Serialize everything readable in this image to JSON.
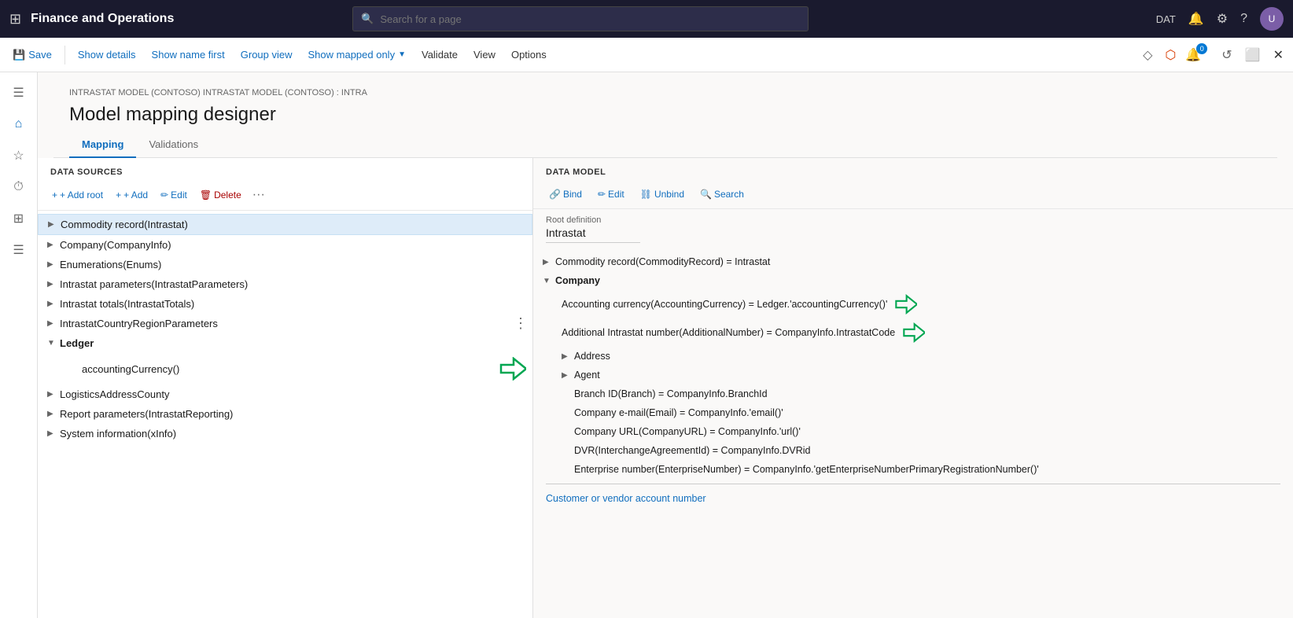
{
  "topNav": {
    "title": "Finance and Operations",
    "searchPlaceholder": "Search for a page",
    "environment": "DAT"
  },
  "toolbar": {
    "save": "Save",
    "showDetails": "Show details",
    "showNameFirst": "Show name first",
    "groupView": "Group view",
    "showMappedOnly": "Show mapped only",
    "validate": "Validate",
    "view": "View",
    "options": "Options"
  },
  "page": {
    "breadcrumb": "INTRASTAT MODEL (CONTOSO) INTRASTAT MODEL (CONTOSO) : INTRA",
    "title": "Model mapping designer",
    "tabs": [
      "Mapping",
      "Validations"
    ]
  },
  "dataSources": {
    "header": "DATA SOURCES",
    "addRoot": "+ Add root",
    "add": "+ Add",
    "edit": "Edit",
    "delete": "Delete",
    "items": [
      {
        "label": "Commodity record(Intrastat)",
        "expanded": false,
        "selected": true,
        "indent": 0,
        "hasChildren": true
      },
      {
        "label": "Company(CompanyInfo)",
        "expanded": false,
        "selected": false,
        "indent": 0,
        "hasChildren": true
      },
      {
        "label": "Enumerations(Enums)",
        "expanded": false,
        "selected": false,
        "indent": 0,
        "hasChildren": true
      },
      {
        "label": "Intrastat parameters(IntrastatParameters)",
        "expanded": false,
        "selected": false,
        "indent": 0,
        "hasChildren": true
      },
      {
        "label": "Intrastat totals(IntrastatTotals)",
        "expanded": false,
        "selected": false,
        "indent": 0,
        "hasChildren": true
      },
      {
        "label": "IntrastatCountryRegionParameters",
        "expanded": false,
        "selected": false,
        "indent": 0,
        "hasChildren": true
      },
      {
        "label": "Ledger",
        "expanded": true,
        "selected": false,
        "indent": 0,
        "hasChildren": true
      },
      {
        "label": "accountingCurrency()",
        "expanded": false,
        "selected": false,
        "indent": 1,
        "hasChildren": false,
        "arrow": true
      },
      {
        "label": "LogisticsAddressCounty",
        "expanded": false,
        "selected": false,
        "indent": 0,
        "hasChildren": true
      },
      {
        "label": "Report parameters(IntrastatReporting)",
        "expanded": false,
        "selected": false,
        "indent": 0,
        "hasChildren": true
      },
      {
        "label": "System information(xInfo)",
        "expanded": false,
        "selected": false,
        "indent": 0,
        "hasChildren": true
      }
    ]
  },
  "dataModel": {
    "header": "DATA MODEL",
    "bind": "Bind",
    "edit": "Edit",
    "unbind": "Unbind",
    "search": "Search",
    "rootDefinitionLabel": "Root definition",
    "rootDefinitionValue": "Intrastat",
    "items": [
      {
        "label": "Commodity record(CommodityRecord) = Intrastat",
        "indent": 0,
        "hasChildren": true,
        "expanded": false
      },
      {
        "label": "Company",
        "indent": 0,
        "hasChildren": true,
        "expanded": true
      },
      {
        "label": "Accounting currency(AccountingCurrency) = Ledger.'accountingCurrency()'",
        "indent": 1,
        "hasChildren": false,
        "arrow": true
      },
      {
        "label": "Additional Intrastat number(AdditionalNumber) = CompanyInfo.IntrastatCode",
        "indent": 1,
        "hasChildren": false,
        "arrow": true
      },
      {
        "label": "Address",
        "indent": 1,
        "hasChildren": true,
        "expanded": false
      },
      {
        "label": "Agent",
        "indent": 1,
        "hasChildren": true,
        "expanded": false
      },
      {
        "label": "Branch ID(Branch) = CompanyInfo.BranchId",
        "indent": 1,
        "hasChildren": false
      },
      {
        "label": "Company e-mail(Email) = CompanyInfo.'email()'",
        "indent": 1,
        "hasChildren": false
      },
      {
        "label": "Company URL(CompanyURL) = CompanyInfo.'url()'",
        "indent": 1,
        "hasChildren": false
      },
      {
        "label": "DVR(InterchangeAgreementId) = CompanyInfo.DVRid",
        "indent": 1,
        "hasChildren": false
      },
      {
        "label": "Enterprise number(EnterpriseNumber) = CompanyInfo.'getEnterpriseNumberPrimaryRegistrationNumber()'",
        "indent": 1,
        "hasChildren": false
      },
      {
        "label": "Customer or vendor account number",
        "indent": 0,
        "hasChildren": false,
        "isBottom": true
      }
    ]
  },
  "icons": {
    "grid": "⊞",
    "search": "🔍",
    "bell": "🔔",
    "gear": "⚙",
    "help": "?",
    "save": "💾",
    "home": "⌂",
    "star": "☆",
    "history": "⏱",
    "calendar": "📅",
    "list": "☰",
    "filter": "▼",
    "expand": "▶",
    "collapse": "▼",
    "add": "+",
    "edit": "✏",
    "delete": "🗑",
    "bind": "🔗",
    "unbind": "⛓",
    "link": "🔗"
  }
}
